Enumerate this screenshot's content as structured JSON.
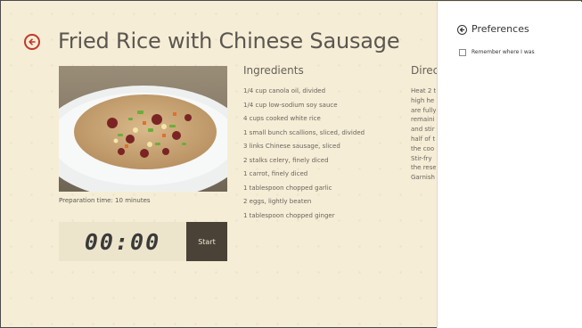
{
  "recipe": {
    "title": "Fried Rice with Chinese Sausage",
    "prep_time": "Preparation time: 10 minutes"
  },
  "timer": {
    "display": "00:00",
    "start_label": "Start"
  },
  "ingredients": {
    "heading": "Ingredients",
    "items": [
      "1/4 cup canola oil, divided",
      "1/4 cup low-sodium soy sauce",
      "4 cups cooked white rice",
      "1 small bunch scallions, sliced, divided",
      "3 links Chinese sausage, sliced",
      "2 stalks celery, finely diced",
      "1 carrot, finely diced",
      "1 tablespoon chopped garlic",
      "2 eggs, lightly beaten",
      "1 tablespoon chopped ginger"
    ]
  },
  "directions": {
    "heading": "Direc",
    "lines": [
      "Heat 2 t",
      "high he",
      "are fully",
      "remaini",
      "and stir",
      "half of t",
      "the coo",
      "Stir-fry",
      "the rese",
      "Garnish"
    ]
  },
  "preferences": {
    "title": "Preferences",
    "remember_label": "Remember where I was"
  },
  "colors": {
    "accent": "#c0392b",
    "background": "#f6edd6",
    "start_button": "#4a4237"
  },
  "icons": {
    "back": "back-arrow-icon",
    "prefs_back": "back-arrow-icon"
  }
}
